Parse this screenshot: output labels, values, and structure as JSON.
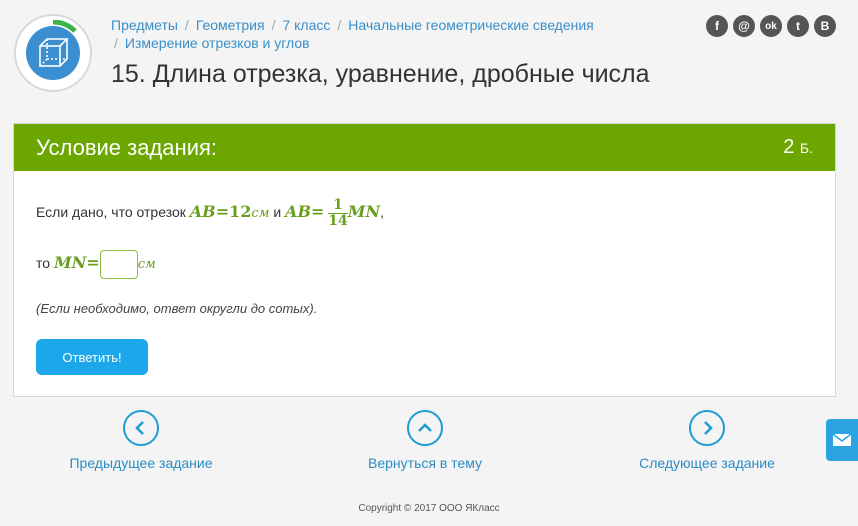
{
  "breadcrumb": {
    "items": [
      "Предметы",
      "Геометрия",
      "7 класс",
      "Начальные геометрические сведения",
      "Измерение отрезков и углов"
    ],
    "separator": "/"
  },
  "page_title": "15. Длина отрезка, уравнение, дробные числа",
  "social": {
    "icons": [
      "facebook-icon",
      "email-icon",
      "odnoklassniki-icon",
      "twitter-icon",
      "vkontakte-icon"
    ],
    "glyphs": [
      "f",
      "@",
      "ok",
      "t",
      "B"
    ]
  },
  "task": {
    "header_title": "Условие задания:",
    "points_value": "2",
    "points_unit": "Б.",
    "line1_prefix": "Если дано, что отрезок ",
    "seg_ab": "AB",
    "eq": "=",
    "len_ab": "12",
    "unit": "см",
    "and": " и ",
    "frac_num": "1",
    "frac_den": "14",
    "seg_mn": "MN",
    "comma": ",",
    "line2_prefix": "то ",
    "answer_value": "",
    "hint": "(Если необходимо, ответ округли до сотых).",
    "submit_label": "Ответить!"
  },
  "navigation": {
    "prev": "Предыдущее задание",
    "back": "Вернуться в тему",
    "next": "Следующее задание"
  },
  "copyright": "Copyright © 2017 ООО ЯКласс",
  "colors": {
    "accent_green": "#6ca600",
    "math_green": "#6a9e1f",
    "link_blue": "#3a8fc8",
    "button_blue": "#1ba7ea"
  }
}
